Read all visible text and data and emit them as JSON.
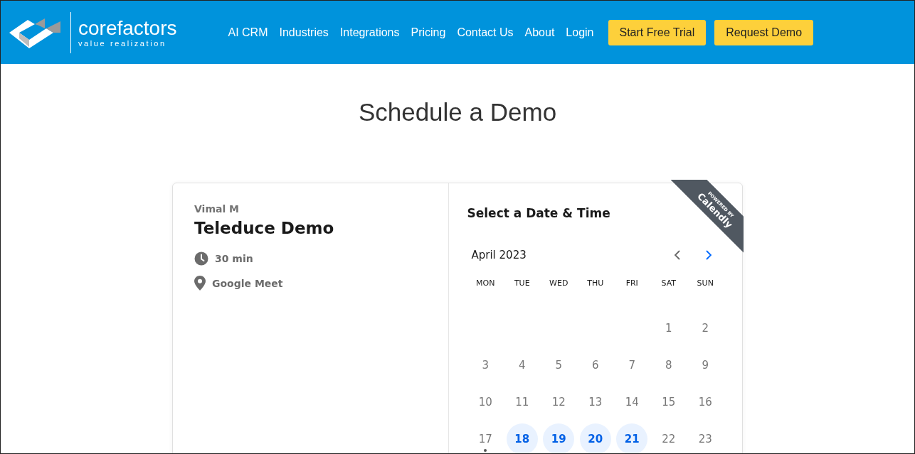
{
  "header": {
    "logo": {
      "name": "corefactors",
      "tagline": "value realization"
    },
    "nav": [
      "AI CRM",
      "Industries",
      "Integrations",
      "Pricing",
      "Contact Us",
      "About",
      "Login"
    ],
    "buttons": [
      "Start Free Trial",
      "Request Demo"
    ]
  },
  "title": "Schedule a Demo",
  "event": {
    "host": "Vimal M",
    "name": "Teleduce Demo",
    "details": [
      {
        "kind": "duration",
        "text": "30 min"
      },
      {
        "kind": "location",
        "text": "Google Meet"
      }
    ]
  },
  "calendar": {
    "heading": "Select a Date & Time",
    "month": "April 2023",
    "prev_enabled": false,
    "next_enabled": true,
    "ribbon": {
      "small": "POWERED BY",
      "big": "Calendly"
    },
    "weekdays": [
      "MON",
      "TUE",
      "WED",
      "THU",
      "FRI",
      "SAT",
      "SUN"
    ],
    "days": [
      {
        "kind": "blank"
      },
      {
        "kind": "blank"
      },
      {
        "kind": "blank"
      },
      {
        "kind": "blank"
      },
      {
        "kind": "blank"
      },
      {
        "kind": "date",
        "label": "1",
        "available": false,
        "today": false
      },
      {
        "kind": "date",
        "label": "2",
        "available": false,
        "today": false
      },
      {
        "kind": "date",
        "label": "3",
        "available": false,
        "today": false
      },
      {
        "kind": "date",
        "label": "4",
        "available": false,
        "today": false
      },
      {
        "kind": "date",
        "label": "5",
        "available": false,
        "today": false
      },
      {
        "kind": "date",
        "label": "6",
        "available": false,
        "today": false
      },
      {
        "kind": "date",
        "label": "7",
        "available": false,
        "today": false
      },
      {
        "kind": "date",
        "label": "8",
        "available": false,
        "today": false
      },
      {
        "kind": "date",
        "label": "9",
        "available": false,
        "today": false
      },
      {
        "kind": "date",
        "label": "10",
        "available": false,
        "today": false
      },
      {
        "kind": "date",
        "label": "11",
        "available": false,
        "today": false
      },
      {
        "kind": "date",
        "label": "12",
        "available": false,
        "today": false
      },
      {
        "kind": "date",
        "label": "13",
        "available": false,
        "today": false
      },
      {
        "kind": "date",
        "label": "14",
        "available": false,
        "today": false
      },
      {
        "kind": "date",
        "label": "15",
        "available": false,
        "today": false
      },
      {
        "kind": "date",
        "label": "16",
        "available": false,
        "today": false
      },
      {
        "kind": "date",
        "label": "17",
        "available": false,
        "today": true
      },
      {
        "kind": "date",
        "label": "18",
        "available": true,
        "today": false
      },
      {
        "kind": "date",
        "label": "19",
        "available": true,
        "today": false
      },
      {
        "kind": "date",
        "label": "20",
        "available": true,
        "today": false
      },
      {
        "kind": "date",
        "label": "21",
        "available": true,
        "today": false
      },
      {
        "kind": "date",
        "label": "22",
        "available": false,
        "today": false
      },
      {
        "kind": "date",
        "label": "23",
        "available": false,
        "today": false
      }
    ]
  }
}
